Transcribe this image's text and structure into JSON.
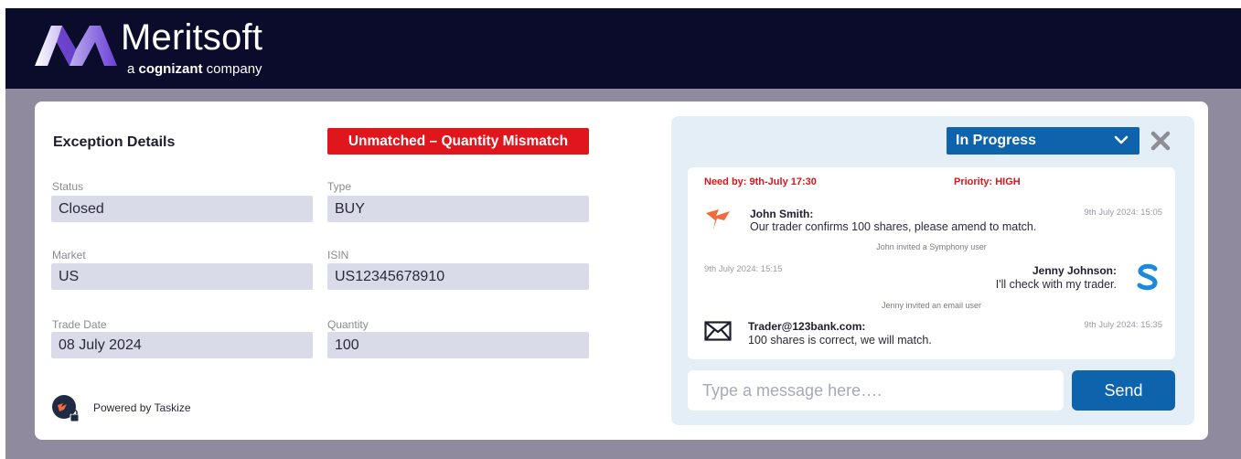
{
  "brand": {
    "name": "Meritsoft",
    "subtitle_prefix": "a ",
    "subtitle_bold": "cognizant",
    "subtitle_suffix": " company"
  },
  "exception": {
    "title": "Exception Details",
    "badge": "Unmatched – Quantity Mismatch",
    "fields": {
      "status": {
        "label": "Status",
        "value": "Closed"
      },
      "type": {
        "label": "Type",
        "value": "BUY"
      },
      "market": {
        "label": "Market",
        "value": "US"
      },
      "isin": {
        "label": "ISIN",
        "value": "US12345678910"
      },
      "trade_date": {
        "label": "Trade Date",
        "value": "08 July 2024"
      },
      "quantity": {
        "label": "Quantity",
        "value": "100"
      }
    },
    "powered_by": "Powered by Taskize"
  },
  "chat": {
    "status_selected": "In Progress",
    "need_by": "Need by: 9th-July 17:30",
    "priority": "Priority: HIGH",
    "messages": [
      {
        "sender": "John Smith:",
        "text": "Our trader confirms 100 shares, please amend to match.",
        "time": "9th July 2024: 15:05"
      },
      {
        "sender": "Jenny Johnson:",
        "text": "I'll check with my trader.",
        "time": "9th July 2024: 15:15"
      },
      {
        "sender": "Trader@123bank.com:",
        "text": "100 shares is correct, we will match.",
        "time": "9th July 2024: 15:35"
      }
    ],
    "system_notes": [
      "John invited a Symphony user",
      "Jenny invited an email user"
    ],
    "input_placeholder": "Type a message here….",
    "send_label": "Send"
  },
  "colors": {
    "header_bg": "#0b0b2b",
    "accent_blue": "#0e63ad",
    "alert_red": "#e0161c",
    "field_bg": "#d9dbe8",
    "frame_bg": "#8f8a9e"
  },
  "icons": [
    "meritsoft-logo-icon",
    "chevron-down-icon",
    "close-icon",
    "taskize-icon",
    "symphony-icon",
    "envelope-icon",
    "lock-icon"
  ]
}
